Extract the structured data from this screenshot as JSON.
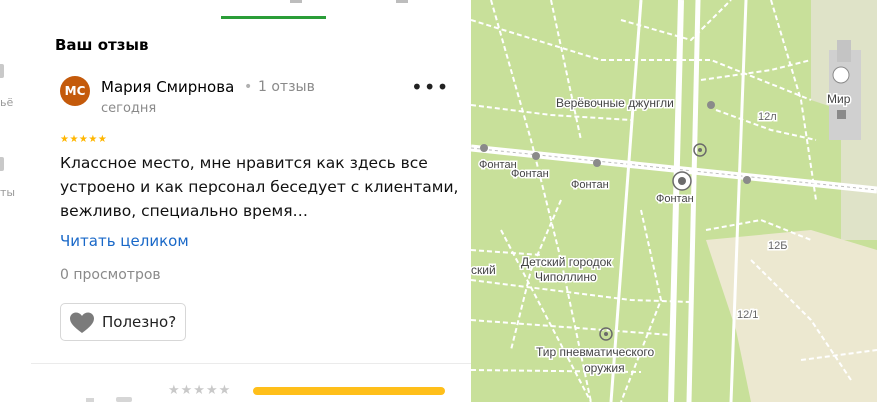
{
  "sidebar": {
    "items": [
      {
        "label": "ьё"
      },
      {
        "label": "ты"
      }
    ]
  },
  "review": {
    "heading": "Ваш отзыв",
    "avatar_initials": "МС",
    "author": "Мария Смирнова",
    "separator": "•",
    "review_count": "1 отзыв",
    "date": "сегодня",
    "rating": 5,
    "stars": "★★★★★",
    "text": "Классное место, мне нравится как здесь все устроено и как персонал беседует с клиентами, вежливо, специально время…",
    "read_more": "Читать целиком",
    "views": "0 просмотров",
    "useful_label": "Полезно?"
  },
  "next_block": {
    "stars": "★★★★★"
  },
  "colors": {
    "accent_green": "#2a9d38",
    "avatar": "#c45a0b",
    "star": "#ffb600",
    "link": "#1968c8",
    "bar": "#ffbf1a",
    "map_park": "#c8e09a"
  },
  "map": {
    "labels": [
      "Мир",
      "Верёвочные джунгли",
      "12л",
      "Фонтан",
      "Фонтан",
      "Фонтан",
      "Фонтан",
      "12Б",
      "ский",
      "Детский городок",
      "Чиполлино",
      "12/1",
      "Тир пневматического",
      "оружия"
    ]
  }
}
